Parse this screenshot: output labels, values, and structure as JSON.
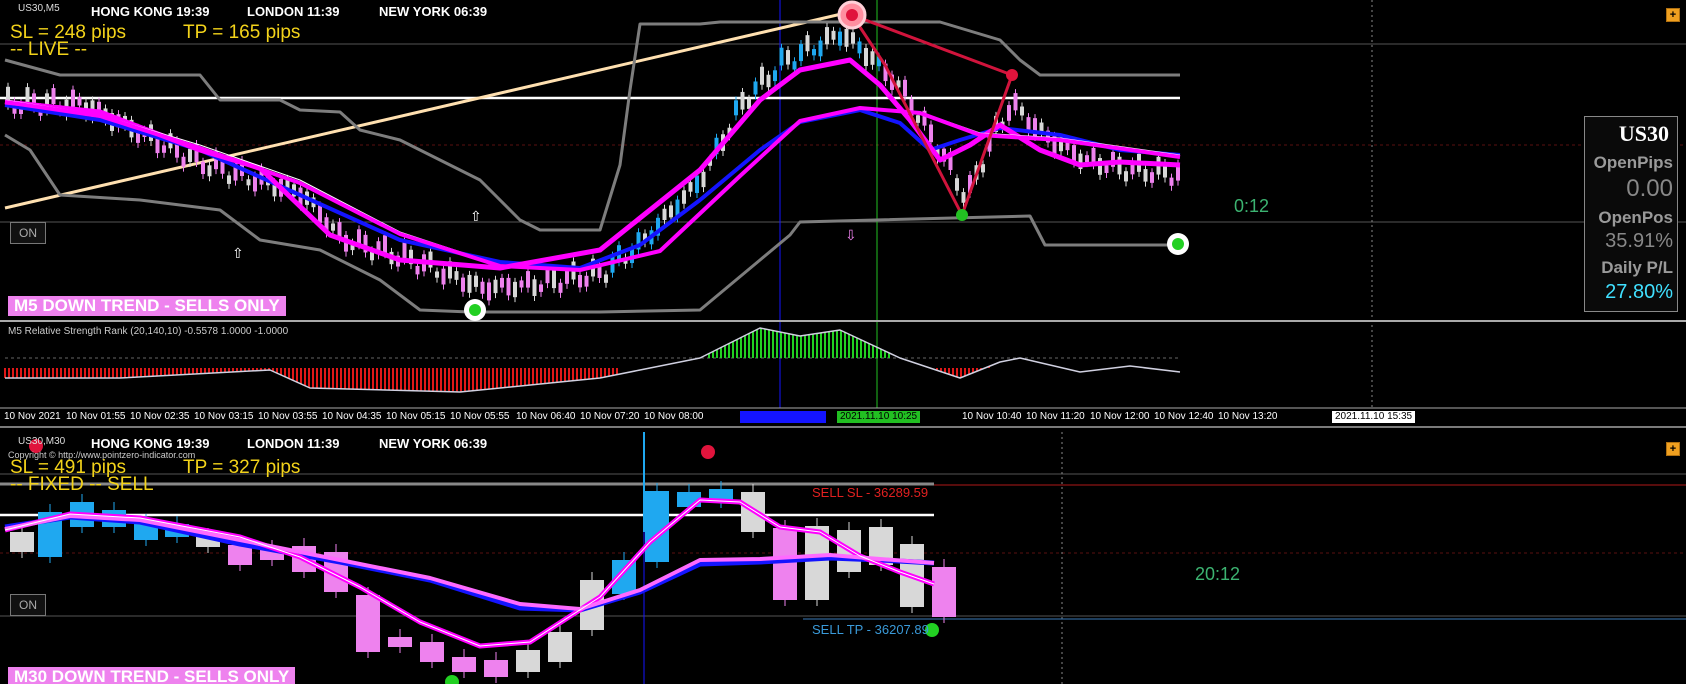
{
  "m5_chart": {
    "symbol_title": "US30,M5",
    "clocks": [
      {
        "label": "HONG KONG 19:39",
        "color": "#a52a2a"
      },
      {
        "label": "LONDON 11:39",
        "color": "#1e73d8"
      },
      {
        "label": "NEW YORK 06:39",
        "color": "#a52a2a"
      }
    ],
    "sl_text": "SL = 248 pips",
    "tp_text": "TP = 165 pips",
    "mode_text": "-- LIVE --",
    "on_button": "ON",
    "trend_banner": "M5  DOWN TREND - SELLS ONLY",
    "candle_timer": "0:12",
    "indicator_label": "M5 Relative Strength Rank (20,140,10) -0.5578 1.0000 -1.0000",
    "time_axis": [
      "10 Nov 2021",
      "10 Nov 01:55",
      "10 Nov 02:35",
      "10 Nov 03:15",
      "10 Nov 03:55",
      "10 Nov 04:35",
      "10 Nov 05:15",
      "10 Nov 05:55",
      "10 Nov 06:40",
      "10 Nov 07:20",
      "10 Nov 08:00",
      "10 Nov 10:40",
      "10 Nov 11:20",
      "10 Nov 12:00",
      "10 Nov 12:40",
      "10 Nov 13:20"
    ],
    "highlight_time_green": "2021.11.10 10:25",
    "highlight_time_white": "2021.11.10 15:35",
    "colors": {
      "bull": "#1fa8f0",
      "bear": "#ee82ee",
      "neutral": "#d8d8d8",
      "ma_fast": "#ff00ff",
      "ma_slow": "#1414ff",
      "channel": "#7d7d7d",
      "trendline": "#ffe0b0",
      "zigzag": "#d0143c"
    }
  },
  "info_panel": {
    "symbol": "US30",
    "open_pips_label": "OpenPips",
    "open_pips_value": "0.00",
    "open_pos_label": "OpenPos",
    "open_pos_value": "35.91%",
    "daily_pl_label": "Daily P/L",
    "daily_pl_value": "27.80%"
  },
  "m30_chart": {
    "symbol_title": "US30,M30",
    "clocks": [
      {
        "label": "HONG KONG 19:39",
        "color": "#a52a2a"
      },
      {
        "label": "LONDON 11:39",
        "color": "#1e73d8"
      },
      {
        "label": "NEW YORK 06:39",
        "color": "#a52a2a"
      }
    ],
    "copyright": "Copyright © http://www.pointzero-indicator.com",
    "sl_text": "SL = 491 pips",
    "tp_text": "TP = 327 pips",
    "mode_text": "-- FIXED -- SELL",
    "on_button": "ON",
    "trend_banner": "M30  DOWN TREND - SELLS ONLY",
    "candle_timer": "20:12",
    "sell_sl_label": "SELL SL - 36289.59",
    "sell_tp_label": "SELL TP - 36207.89"
  }
}
